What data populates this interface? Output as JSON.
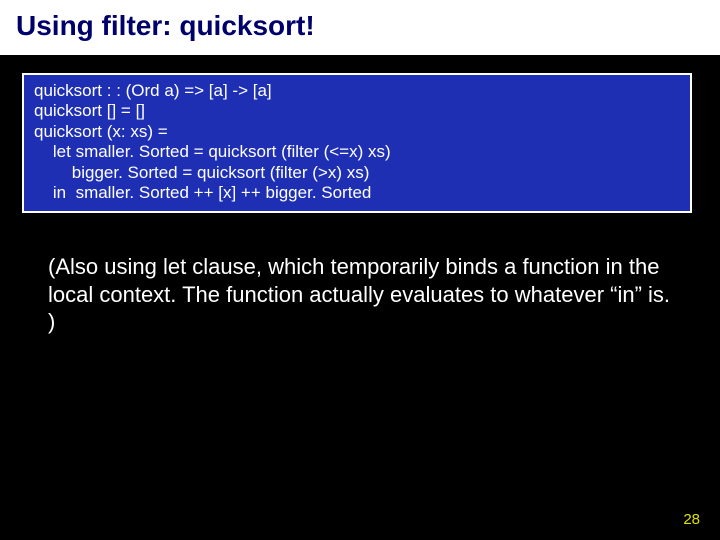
{
  "title": "Using filter: quicksort!",
  "code": {
    "l1": "quicksort : : (Ord a) => [a] -> [a]",
    "l2": "quicksort [] = []",
    "l3": "quicksort (x: xs) =",
    "l4": "    let smaller. Sorted = quicksort (filter (<=x) xs)",
    "l5": "        bigger. Sorted = quicksort (filter (>x) xs)",
    "l6": "    in  smaller. Sorted ++ [x] ++ bigger. Sorted"
  },
  "body": "(Also using let clause, which temporarily binds a function in the local context.  The function actually evaluates to whatever “in” is. )",
  "page_number": "28"
}
